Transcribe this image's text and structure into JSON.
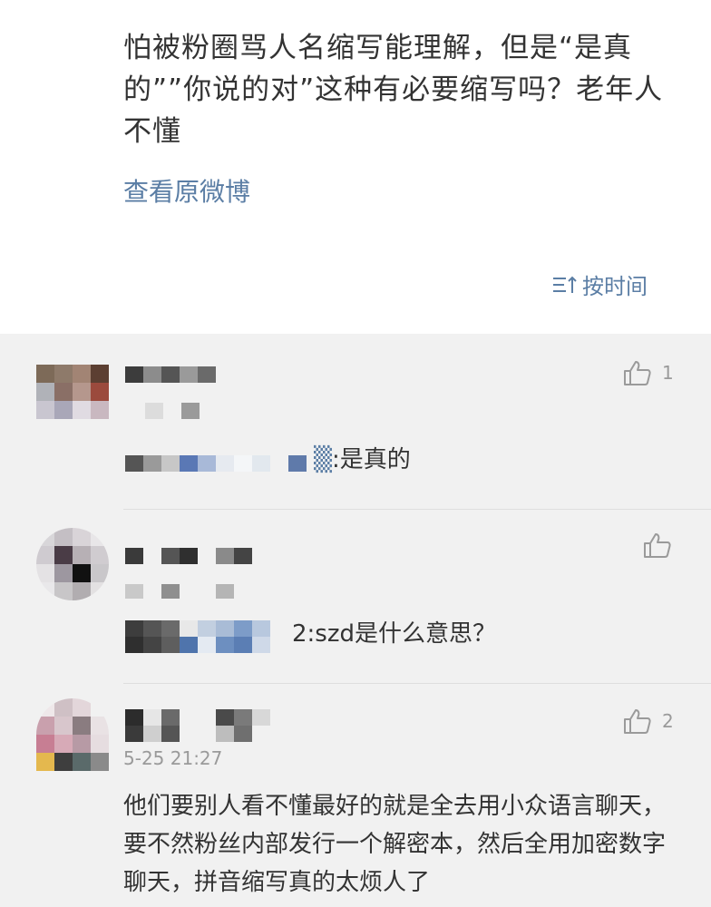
{
  "post": {
    "text": "怕被粉圈骂人名缩写能理解，但是“是真的””你说的对”这种有必要缩写吗？老年人不懂",
    "view_original": "查看原微博",
    "sort_label": "按时间"
  },
  "comments": [
    {
      "reply_suffix": ":是真的",
      "likes": "1"
    },
    {
      "reply_suffix": "2:szd是什么意思？",
      "likes": ""
    },
    {
      "time": "5-25 21:27",
      "likes": "2",
      "text": "他们要别人看不懂最好的就是全去用小众语言聊天，要不然粉丝内部发行一个解密本，然后全用加密数字聊天，拼音缩写真的太烦人了"
    }
  ],
  "icons": {
    "like": "thumbs-up-icon",
    "sort": "sort-icon"
  },
  "colors": {
    "link": "#5b7ea5",
    "text": "#333333",
    "meta": "#9a9a9a",
    "page": "#f1f1f1"
  }
}
